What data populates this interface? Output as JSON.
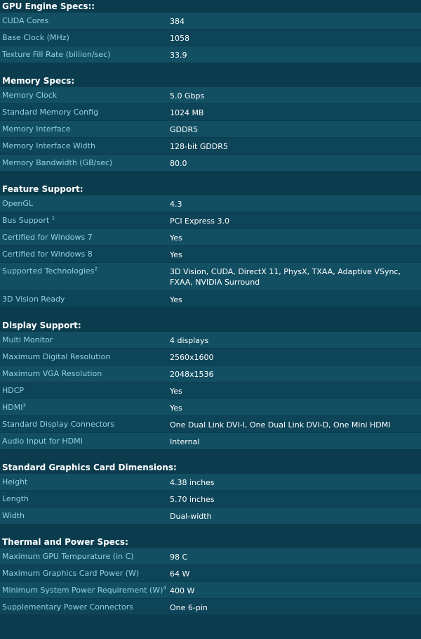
{
  "sections": [
    {
      "title": "GPU Engine Specs::",
      "rows": [
        {
          "label": "CUDA Cores",
          "sup": "",
          "value": "384"
        },
        {
          "label": "Base Clock (MHz)",
          "sup": "",
          "value": "1058"
        },
        {
          "label": "Texture Fill Rate (billion/sec)",
          "sup": "",
          "value": "33.9"
        }
      ]
    },
    {
      "title": "Memory Specs:",
      "rows": [
        {
          "label": "Memory Clock",
          "sup": "",
          "value": "5.0 Gbps"
        },
        {
          "label": "Standard Memory Config",
          "sup": "",
          "value": "1024 MB"
        },
        {
          "label": "Memory Interface",
          "sup": "",
          "value": "GDDR5"
        },
        {
          "label": "Memory Interface Width",
          "sup": "",
          "value": "128-bit GDDR5"
        },
        {
          "label": "Memory Bandwidth (GB/sec)",
          "sup": "",
          "value": "80.0"
        }
      ]
    },
    {
      "title": "Feature Support:",
      "rows": [
        {
          "label": "OpenGL",
          "sup": "",
          "value": "4.3"
        },
        {
          "label": "Bus Support ",
          "sup": "1",
          "value": "PCI Express 3.0"
        },
        {
          "label": "Certified for Windows 7",
          "sup": "",
          "value": "Yes"
        },
        {
          "label": "Certified for Windows 8",
          "sup": "",
          "value": "Yes"
        },
        {
          "label": "Supported Technologies",
          "sup": "2",
          "value": "3D Vision, CUDA, DirectX 11, PhysX, TXAA, Adaptive VSync, FXAA, NVIDIA Surround"
        },
        {
          "label": "3D Vision Ready",
          "sup": "",
          "value": "Yes"
        }
      ]
    },
    {
      "title": "Display Support:",
      "rows": [
        {
          "label": "Multi Monitor",
          "sup": "",
          "value": "4 displays"
        },
        {
          "label": "Maximum Digital Resolution",
          "sup": "",
          "value": "2560x1600"
        },
        {
          "label": "Maximum VGA Resolution",
          "sup": "",
          "value": "2048x1536"
        },
        {
          "label": "HDCP",
          "sup": "",
          "value": "Yes"
        },
        {
          "label": "HDMI",
          "sup": "3",
          "value": "Yes"
        },
        {
          "label": "Standard Display Connectors",
          "sup": "",
          "value": "One Dual Link DVI-I, One Dual Link DVI-D, One Mini HDMI"
        },
        {
          "label": "Audio Input for HDMI",
          "sup": "",
          "value": "Internal"
        }
      ]
    },
    {
      "title": "Standard Graphics Card Dimensions:",
      "rows": [
        {
          "label": "Height",
          "sup": "",
          "value": "4.38 inches"
        },
        {
          "label": "Length",
          "sup": "",
          "value": "5.70 inches"
        },
        {
          "label": "Width",
          "sup": "",
          "value": "Dual-width"
        }
      ]
    },
    {
      "title": "Thermal and Power Specs:",
      "rows": [
        {
          "label": "Maximum GPU Tempurature (in C)",
          "sup": "",
          "value": "98 C"
        },
        {
          "label": "Maximum Graphics Card Power (W)",
          "sup": "",
          "value": "64 W"
        },
        {
          "label": "Minimum System Power Requirement (W)",
          "sup": "4",
          "value": "400 W"
        },
        {
          "label": "Supplementary Power Connectors",
          "sup": "",
          "value": "One 6-pin"
        }
      ]
    }
  ]
}
